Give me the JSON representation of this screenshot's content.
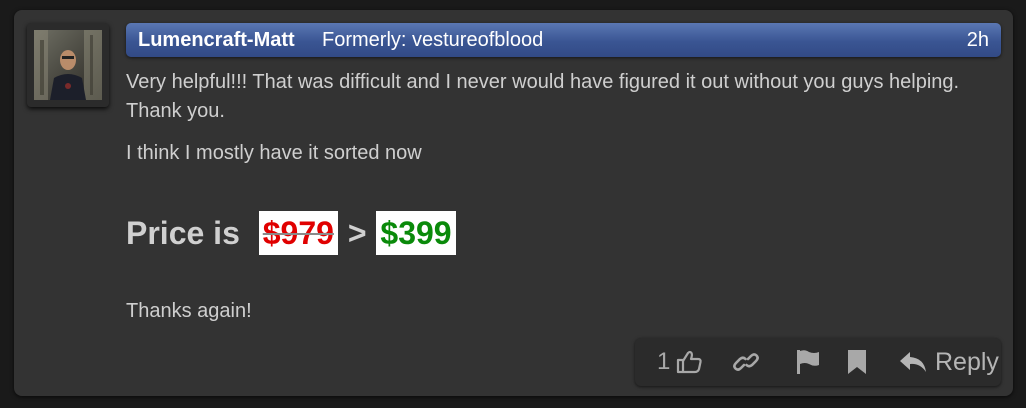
{
  "post": {
    "username": "Lumencraft-Matt",
    "formerly": "Formerly: vestureofblood",
    "time": "2h",
    "paragraph1": "Very helpful!!! That was difficult and I never would have figured it out without you guys helping. Thank you.",
    "paragraph2": "I think I mostly have it sorted now",
    "price_prefix": "Price is",
    "old_price": "$979",
    "arrow": ">",
    "new_price": "$399",
    "paragraph4": "Thanks again!"
  },
  "actions": {
    "like_count": "1",
    "like_icon": "thumbs-up-icon",
    "link_icon": "link-icon",
    "flag_icon": "flag-icon",
    "bookmark_icon": "bookmark-icon",
    "reply_icon": "reply-icon",
    "reply_label": "Reply"
  },
  "colors": {
    "meta_bar": "#3a5593",
    "old_price": "#e00000",
    "new_price": "#0a8a0a",
    "post_bg": "#333333"
  }
}
